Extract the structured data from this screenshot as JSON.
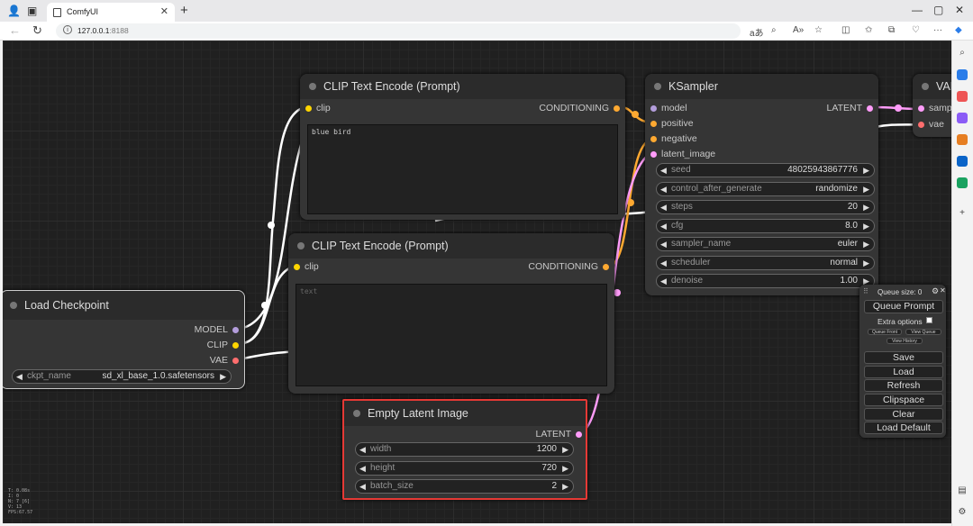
{
  "browser": {
    "tab_title": "ComfyUI",
    "url_host": "127.0.0.1",
    "url_port": ":8188",
    "close": "✕",
    "new_tab": "+"
  },
  "nodes": {
    "clip_pos": {
      "title": "CLIP Text Encode (Prompt)",
      "input": "clip",
      "output": "CONDITIONING",
      "text": "blue bird"
    },
    "clip_neg": {
      "title": "CLIP Text Encode (Prompt)",
      "input": "clip",
      "output": "CONDITIONING",
      "text_placeholder": "text"
    },
    "ksampler": {
      "title": "KSampler",
      "inputs": [
        "model",
        "positive",
        "negative",
        "latent_image"
      ],
      "output": "LATENT",
      "widgets": [
        {
          "name": "seed",
          "value": "48025943867776"
        },
        {
          "name": "control_after_generate",
          "value": "randomize"
        },
        {
          "name": "steps",
          "value": "20"
        },
        {
          "name": "cfg",
          "value": "8.0"
        },
        {
          "name": "sampler_name",
          "value": "euler"
        },
        {
          "name": "scheduler",
          "value": "normal"
        },
        {
          "name": "denoise",
          "value": "1.00"
        }
      ]
    },
    "vae_decode": {
      "title": "VAE",
      "inputs": [
        "sampl",
        "vae"
      ]
    },
    "checkpoint": {
      "title": "Load Checkpoint",
      "outputs": [
        "MODEL",
        "CLIP",
        "VAE"
      ],
      "widget": {
        "name": "ckpt_name",
        "value": "sd_xl_base_1.0.safetensors"
      }
    },
    "latent": {
      "title": "Empty Latent Image",
      "output": "LATENT",
      "widgets": [
        {
          "name": "width",
          "value": "1200"
        },
        {
          "name": "height",
          "value": "720"
        },
        {
          "name": "batch_size",
          "value": "2"
        }
      ]
    }
  },
  "menu": {
    "queue_size": "Queue size: 0",
    "queue_prompt": "Queue Prompt",
    "extra_options": "Extra options",
    "queue_front": "Queue Front",
    "view_queue": "View Queue",
    "view_history": "View History",
    "buttons": [
      "Save",
      "Load",
      "Refresh",
      "Clipspace",
      "Clear",
      "Load Default"
    ]
  },
  "stats": [
    "T: 0.08s",
    "I: 0",
    "N: 7 [6]",
    "V: 13",
    "FPS:67.57"
  ],
  "colors": {
    "model": "#b39ddb",
    "clip": "#ffd500",
    "vae": "#ff6e6e",
    "conditioning": "#ffa931",
    "latent": "#ff9cf9",
    "highlight": "#e53935"
  },
  "widget_arrows": {
    "left": "◀",
    "right": "▶"
  }
}
